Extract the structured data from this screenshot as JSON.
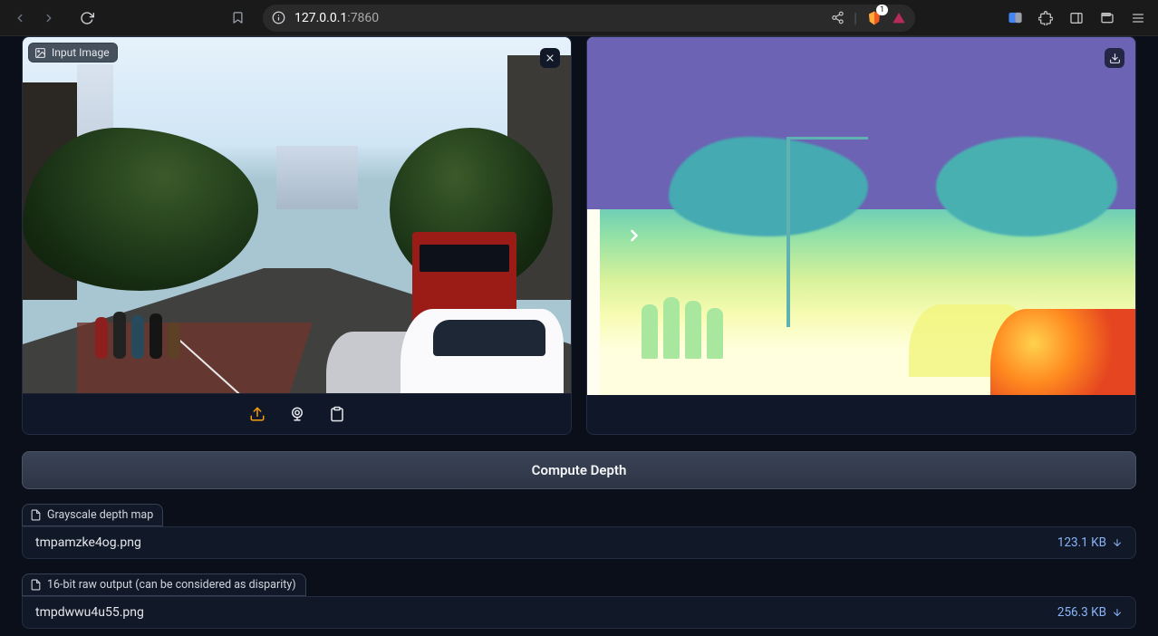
{
  "browser": {
    "url_host": "127.0.0.1",
    "url_port": ":7860",
    "shield_badge": "1"
  },
  "left_panel": {
    "label": "Input Image"
  },
  "compute_button_label": "Compute Depth",
  "outputs": [
    {
      "label": "Grayscale depth map",
      "filename": "tmpamzke4og.png",
      "size": "123.1 KB"
    },
    {
      "label": "16-bit raw output (can be considered as disparity)",
      "filename": "tmpdwwu4u55.png",
      "size": "256.3 KB"
    }
  ]
}
